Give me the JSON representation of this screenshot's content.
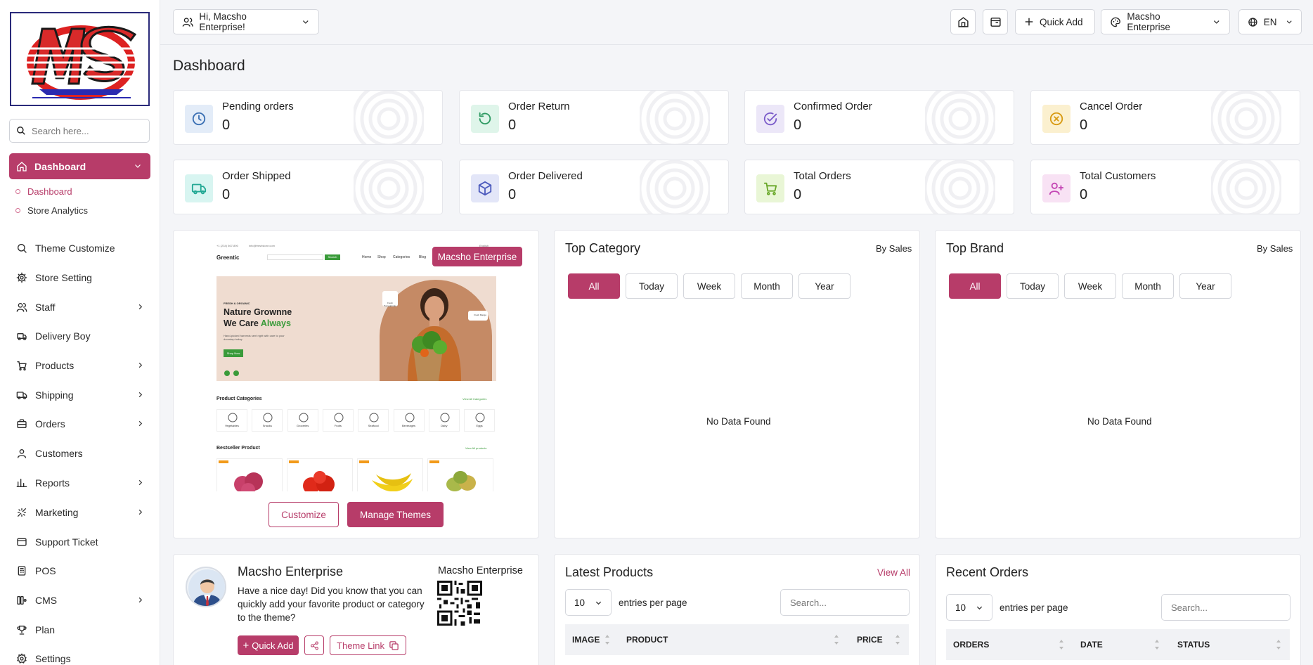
{
  "sidebar": {
    "search_placeholder": "Search here...",
    "dashboard_label": "Dashboard",
    "sub_items": [
      "Dashboard",
      "Store Analytics"
    ],
    "items": [
      {
        "label": "Theme Customize",
        "icon": "brush-icon",
        "arrow": false
      },
      {
        "label": "Store Setting",
        "icon": "gear-icon",
        "arrow": false
      },
      {
        "label": "Staff",
        "icon": "users-icon",
        "arrow": true
      },
      {
        "label": "Delivery Boy",
        "icon": "delivery-icon",
        "arrow": false
      },
      {
        "label": "Products",
        "icon": "cart-icon",
        "arrow": true
      },
      {
        "label": "Shipping",
        "icon": "truck-icon",
        "arrow": true
      },
      {
        "label": "Orders",
        "icon": "briefcase-icon",
        "arrow": true
      },
      {
        "label": "Customers",
        "icon": "user-icon",
        "arrow": false
      },
      {
        "label": "Reports",
        "icon": "bar-chart-icon",
        "arrow": true
      },
      {
        "label": "Marketing",
        "icon": "marketing-icon",
        "arrow": true
      },
      {
        "label": "Support Ticket",
        "icon": "ticket-icon",
        "arrow": false
      },
      {
        "label": "POS",
        "icon": "pos-icon",
        "arrow": false
      },
      {
        "label": "CMS",
        "icon": "cms-icon",
        "arrow": true
      },
      {
        "label": "Plan",
        "icon": "trophy-icon",
        "arrow": false
      },
      {
        "label": "Settings",
        "icon": "settings-icon",
        "arrow": false
      }
    ]
  },
  "topbar": {
    "greeting": "Hi, Macsho Enterprise!",
    "quick_add": "Quick Add",
    "store_name": "Macsho Enterprise",
    "language": "EN"
  },
  "page": {
    "title": "Dashboard"
  },
  "stats": [
    {
      "label": "Pending orders",
      "value": "0",
      "icon": "clock-icon",
      "bg": "#e3ecf8",
      "fg": "#3a6fb3"
    },
    {
      "label": "Order Return",
      "value": "0",
      "icon": "refresh-icon",
      "bg": "#dff5ea",
      "fg": "#2e9a62"
    },
    {
      "label": "Confirmed Order",
      "value": "0",
      "icon": "check-circle-icon",
      "bg": "#ece7f8",
      "fg": "#7a5bc9"
    },
    {
      "label": "Cancel Order",
      "value": "0",
      "icon": "x-circle-icon",
      "bg": "#fbf0cf",
      "fg": "#d89a12"
    },
    {
      "label": "Order Shipped",
      "value": "0",
      "icon": "truck-icon",
      "bg": "#d8f5f1",
      "fg": "#23a894"
    },
    {
      "label": "Order Delivered",
      "value": "0",
      "icon": "box-icon",
      "bg": "#e3e6f8",
      "fg": "#4d5bbd"
    },
    {
      "label": "Total Orders",
      "value": "0",
      "icon": "cart-icon",
      "bg": "#e9f6d6",
      "fg": "#6aa82a"
    },
    {
      "label": "Total Customers",
      "value": "0",
      "icon": "user-plus-icon",
      "bg": "#f8e2f4",
      "fg": "#c446b4"
    }
  ],
  "theme_card": {
    "badge": "Macsho Enterprise",
    "customize": "Customize",
    "manage": "Manage Themes",
    "preview": {
      "topline_left": "+1 (234) 567-890",
      "topline_mid": "info@freshstore.com",
      "topline_right": "English",
      "brand": "Greentic",
      "nav": [
        "Home",
        "Shop",
        "Categories",
        "Blog"
      ],
      "search_btn": "Search",
      "hero_kicker": "FRESH & ORGANIC",
      "hero_line1": "Nature Grownne",
      "hero_line2a": "We Care",
      "hero_line2b": "Always",
      "hero_sub": "Hand-picked harvests sent right with care to your doorstep today.",
      "hero_btn": "Shop Now",
      "tag1": "Fresh Pomegranate",
      "tag2": "Fresh Mango",
      "categories_title": "Product Categories",
      "categories_link": "View All Categories",
      "categories": [
        "Vegetables",
        "Snacks",
        "Groceries",
        "Fruits",
        "Seafood",
        "Beverages",
        "Dairy",
        "Eggs"
      ],
      "bestseller_title": "Bestseller Product",
      "bestseller_link": "View All products"
    }
  },
  "top_category": {
    "title": "Top Category",
    "by": "By Sales",
    "tabs": [
      "All",
      "Today",
      "Week",
      "Month",
      "Year"
    ],
    "empty": "No Data Found"
  },
  "top_brand": {
    "title": "Top Brand",
    "by": "By Sales",
    "tabs": [
      "All",
      "Today",
      "Week",
      "Month",
      "Year"
    ],
    "empty": "No Data Found"
  },
  "welcome": {
    "name": "Macsho Enterprise",
    "message": "Have a nice day! Did you know that you can quickly add your favorite product or category to the theme?",
    "qr_title": "Macsho Enterprise",
    "quick_add": "Quick Add",
    "theme_link": "Theme Link"
  },
  "latest_products": {
    "title": "Latest Products",
    "view_all": "View All",
    "entries": "10",
    "entries_label": "entries per page",
    "search_placeholder": "Search...",
    "columns": [
      "IMAGE",
      "PRODUCT",
      "PRICE"
    ]
  },
  "recent_orders": {
    "title": "Recent Orders",
    "entries": "10",
    "entries_label": "entries per page",
    "search_placeholder": "Search...",
    "columns": [
      "ORDERS",
      "DATE",
      "STATUS"
    ]
  },
  "colors": {
    "accent": "#b73c69"
  }
}
